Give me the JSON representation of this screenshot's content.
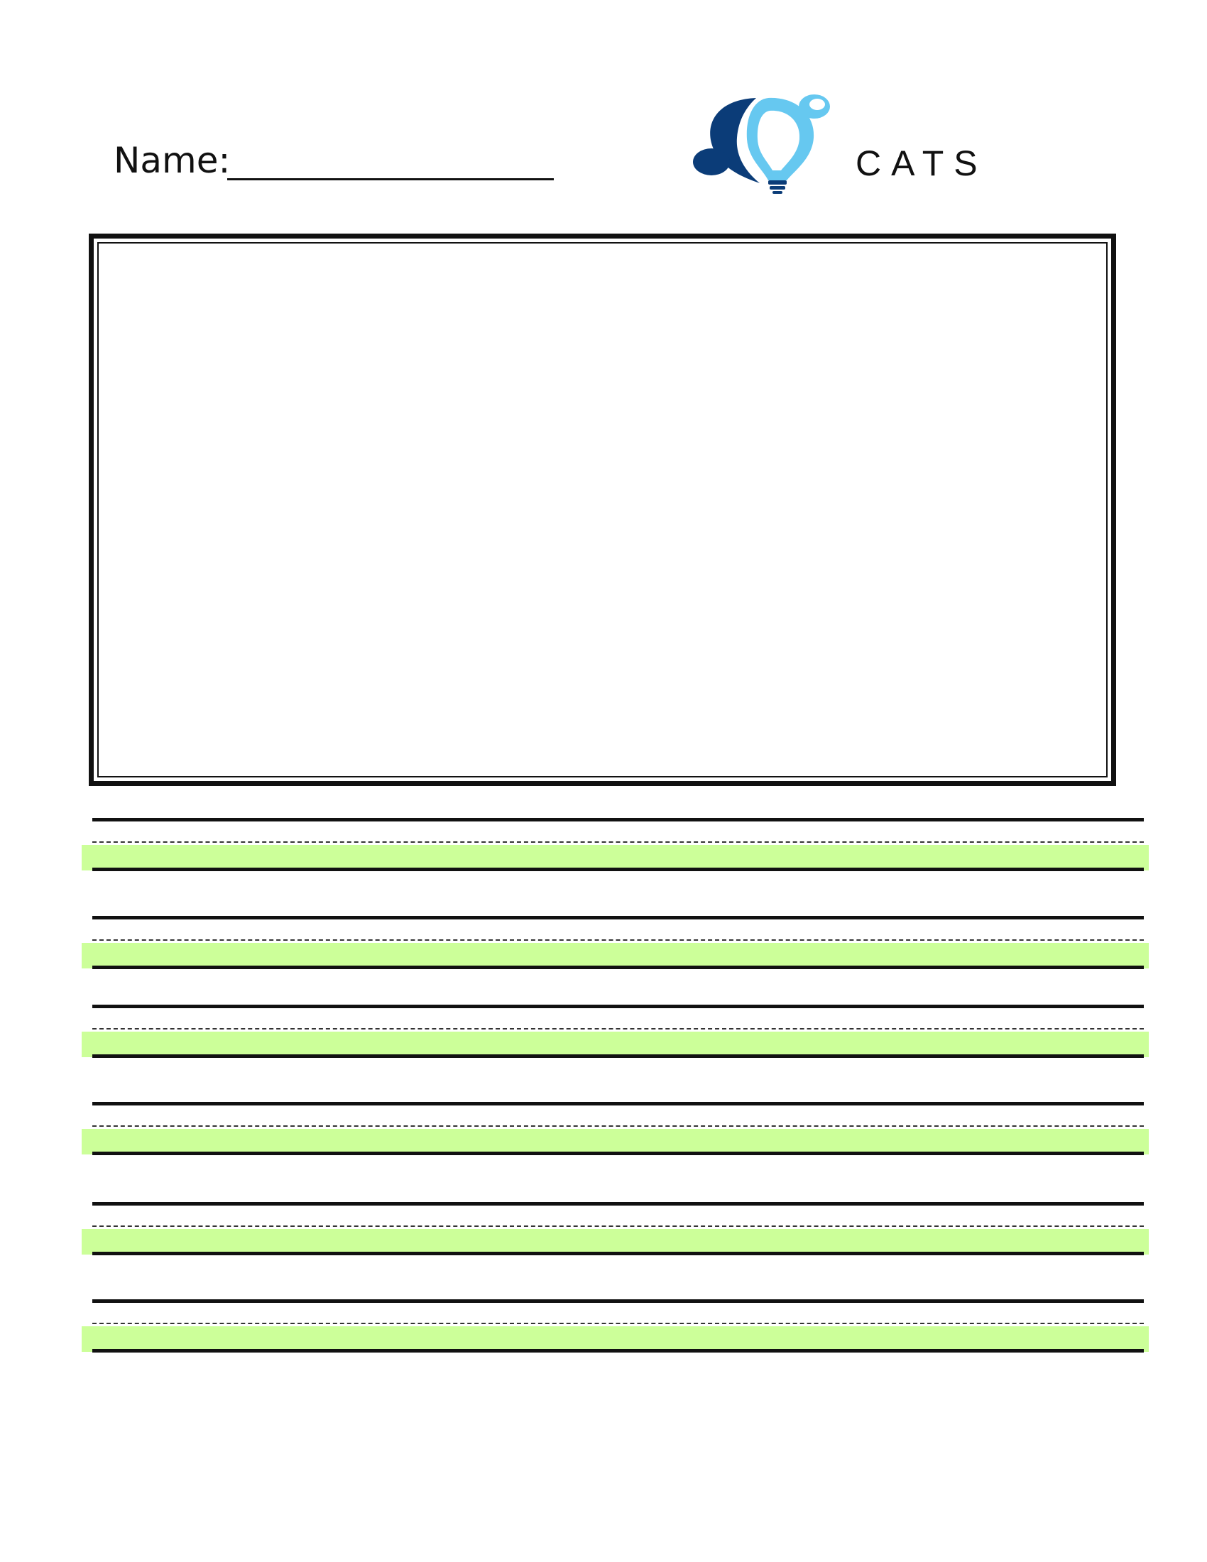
{
  "header": {
    "name_label": "Name:",
    "name_value": "",
    "logo_text": "CATS"
  },
  "drawing_box": {
    "content": ""
  },
  "writing_lines": {
    "count": 6,
    "lines": [
      "",
      "",
      "",
      "",
      "",
      ""
    ]
  },
  "colors": {
    "logo_dark_blue": "#0b3c78",
    "logo_light_blue": "#66c8f0",
    "highlight_band": "#ccff99",
    "rule": "#111111"
  }
}
